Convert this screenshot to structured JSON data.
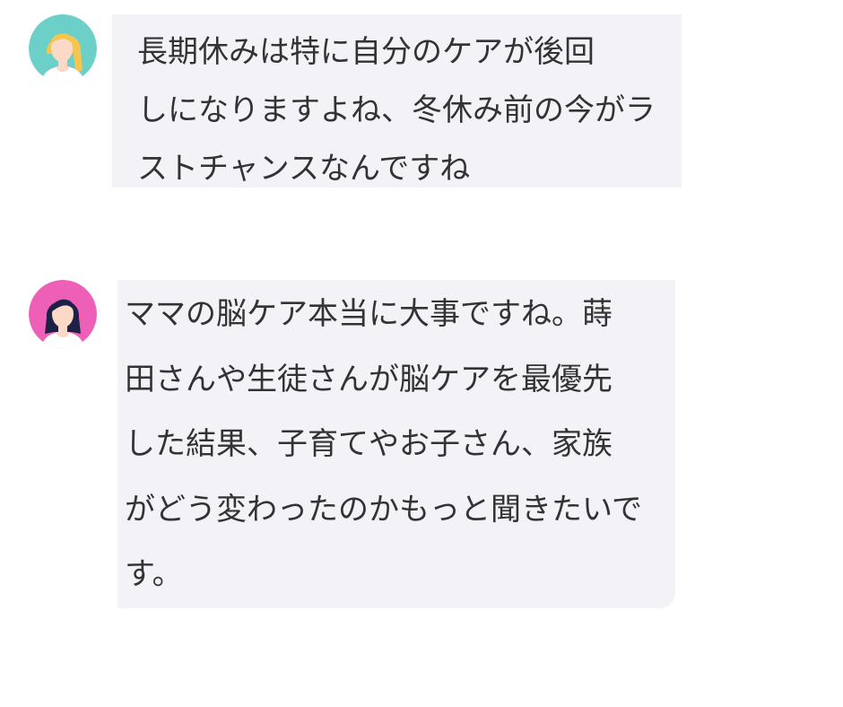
{
  "messages": [
    {
      "avatar": {
        "icon": "woman-blonde-avatar-icon",
        "bg_color": "#6cd0c8",
        "hair_color": "#f5c54f"
      },
      "lines": [
        "長期休みは特に自分のケアが後回",
        "しになりますよね、冬休み前の今がラ",
        "ストチャンスなんですね"
      ]
    },
    {
      "avatar": {
        "icon": "woman-dark-hair-avatar-icon",
        "bg_color": "#ee5fb8",
        "hair_color": "#1e2147"
      },
      "lines": [
        "ママの脳ケア本当に大事ですね。蒔",
        "田さんや生徒さんが脳ケアを最優先",
        "した結果、子育てやお子さん、家族",
        "がどう変わったのかもっと聞きたいで",
        "す。"
      ]
    }
  ],
  "colors": {
    "bubble_bg": "#f2f2f7",
    "text": "#333333",
    "skin": "#fcd9c6"
  }
}
